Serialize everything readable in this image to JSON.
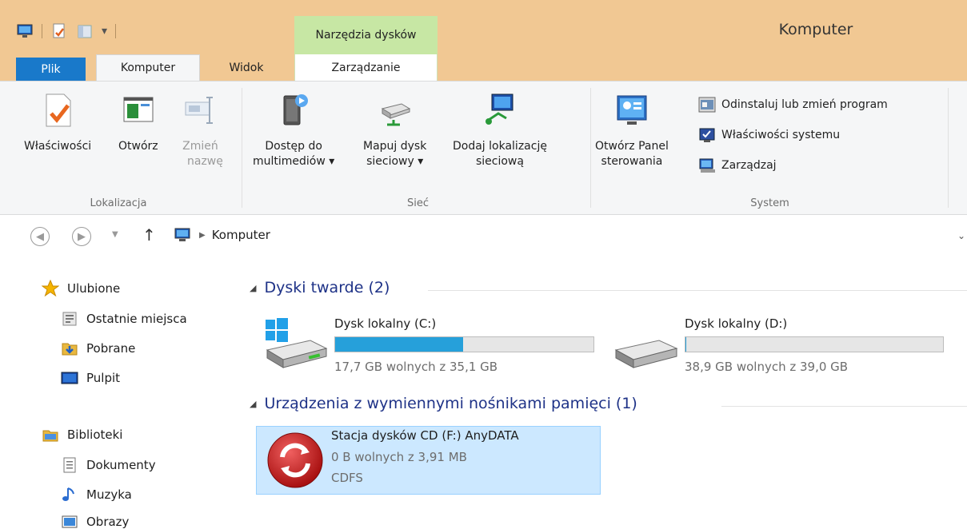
{
  "window": {
    "title": "Komputer",
    "context_tab": "Narzędzia dysków"
  },
  "tabs": {
    "file": "Plik",
    "computer": "Komputer",
    "view": "Widok",
    "manage": "Zarządzanie"
  },
  "ribbon": {
    "location": {
      "label": "Lokalizacja",
      "properties": "Właściwości",
      "open": "Otwórz",
      "rename_1": "Zmień",
      "rename_2": "nazwę"
    },
    "network": {
      "label": "Sieć",
      "media_1": "Dostęp do",
      "media_2": "multimediów",
      "map_1": "Mapuj dysk",
      "map_2": "sieciowy",
      "add_1": "Dodaj lokalizację",
      "add_2": "sieciową"
    },
    "system": {
      "label": "System",
      "panel_1": "Otwórz Panel",
      "panel_2": "sterowania",
      "uninstall": "Odinstaluj lub zmień program",
      "sysprops": "Właściwości systemu",
      "manage": "Zarządzaj"
    }
  },
  "address": {
    "path": "Komputer"
  },
  "nav": {
    "favorites": "Ulubione",
    "recent": "Ostatnie miejsca",
    "downloads": "Pobrane",
    "desktop": "Pulpit",
    "libraries": "Biblioteki",
    "documents": "Dokumenty",
    "music": "Muzyka",
    "pictures": "Obrazy"
  },
  "content": {
    "hdd_header": "Dyski twarde (2)",
    "removable_header": "Urządzenia z wymiennymi nośnikami pamięci (1)",
    "drives": [
      {
        "name": "Dysk lokalny (C:)",
        "info": "17,7 GB wolnych z 35,1 GB",
        "used_fraction": 0.496
      },
      {
        "name": "Dysk lokalny (D:)",
        "info": "38,9 GB wolnych z 39,0 GB",
        "used_fraction": 0.003
      }
    ],
    "cd": {
      "name": "Stacja dysków CD (F:) AnyDATA",
      "info": "0 B wolnych z 3,91 MB",
      "fs": "CDFS"
    }
  },
  "colors": {
    "titlebar": "#f1c893",
    "context_tab": "#c7e7a4",
    "file_tab": "#1979ca",
    "progress": "#26a0da",
    "section": "#1e3287",
    "selection": "#cce8ff"
  }
}
